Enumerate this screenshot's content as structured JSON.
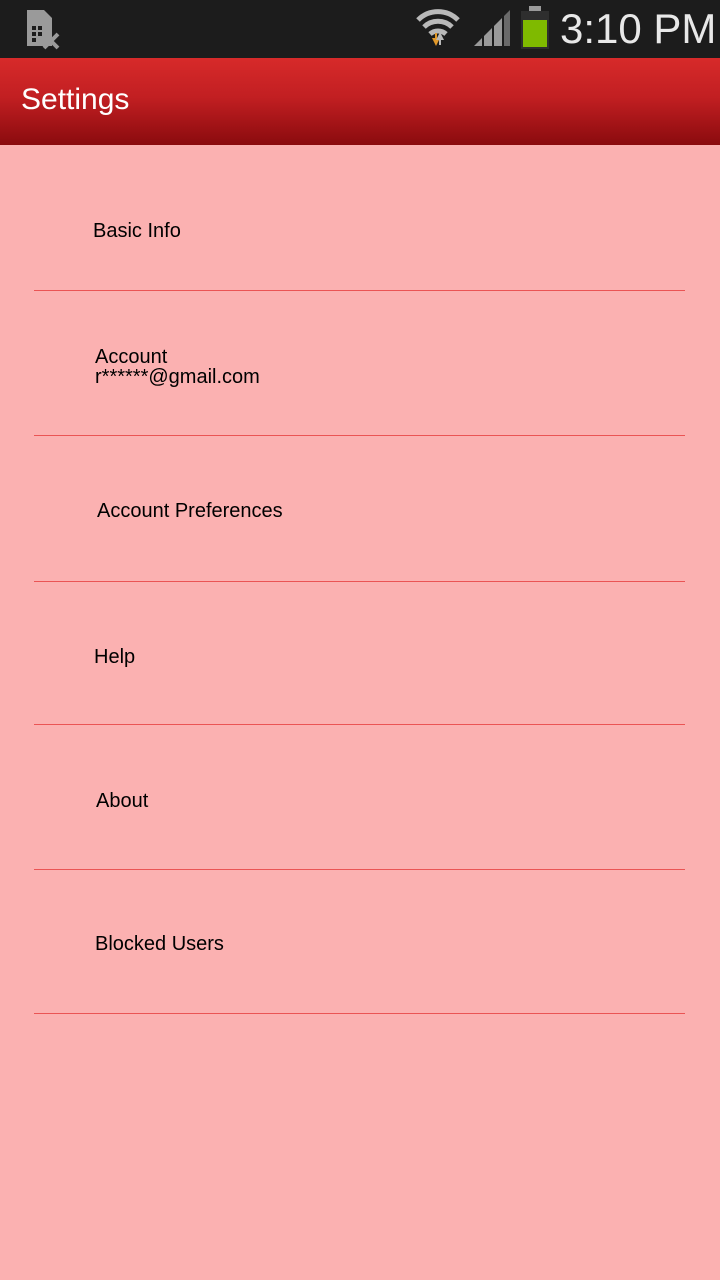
{
  "status_bar": {
    "time": "3:10 PM",
    "icons": {
      "left": "sim-card-error-icon",
      "wifi": "wifi-data-transfer-icon",
      "signal": "cell-signal-icon",
      "battery": "battery-icon"
    },
    "battery_color": "#7fba00"
  },
  "app_bar": {
    "title": "Settings",
    "gradient_top": "#d72a2a",
    "gradient_bottom": "#8a0b0e"
  },
  "settings": {
    "items": [
      {
        "label": "Basic Info"
      },
      {
        "label": "Account",
        "sublabel": "r******@gmail.com"
      },
      {
        "label": "Account Preferences"
      },
      {
        "label": "Help"
      },
      {
        "label": "About"
      },
      {
        "label": "Blocked Users"
      }
    ]
  },
  "colors": {
    "background": "#fbb1b1",
    "divider": "#ea5454"
  }
}
